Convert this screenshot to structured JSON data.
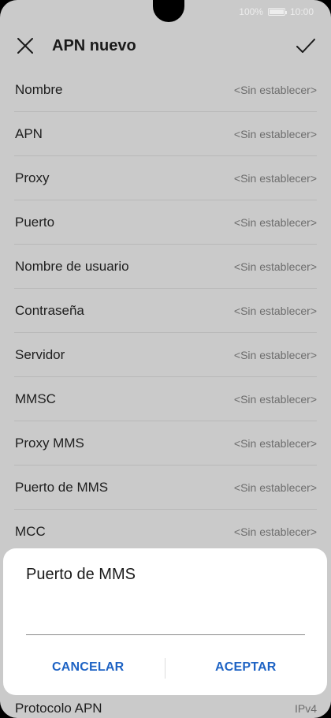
{
  "status_bar": {
    "battery_percent": "100%",
    "time": "10:00"
  },
  "header": {
    "title": "APN nuevo"
  },
  "fields": [
    {
      "label": "Nombre",
      "value": "<Sin establecer>"
    },
    {
      "label": "APN",
      "value": "<Sin establecer>"
    },
    {
      "label": "Proxy",
      "value": "<Sin establecer>"
    },
    {
      "label": "Puerto",
      "value": "<Sin establecer>"
    },
    {
      "label": "Nombre de usuario",
      "value": "<Sin establecer>"
    },
    {
      "label": "Contraseña",
      "value": "<Sin establecer>"
    },
    {
      "label": "Servidor",
      "value": "<Sin establecer>"
    },
    {
      "label": "MMSC",
      "value": "<Sin establecer>"
    },
    {
      "label": "Proxy MMS",
      "value": "<Sin establecer>"
    },
    {
      "label": "Puerto de MMS",
      "value": "<Sin establecer>"
    },
    {
      "label": "MCC",
      "value": "<Sin establecer>"
    }
  ],
  "bottom_field": {
    "label": "Protocolo APN",
    "value": "IPv4"
  },
  "dialog": {
    "title": "Puerto de MMS",
    "input_value": "",
    "cancel_label": "CANCELAR",
    "accept_label": "ACEPTAR"
  },
  "colors": {
    "accent": "#1e63c4",
    "scrim": "#cacaca",
    "dialog_bg": "#ffffff"
  },
  "icons": {
    "close": "close-icon",
    "confirm": "check-icon"
  }
}
